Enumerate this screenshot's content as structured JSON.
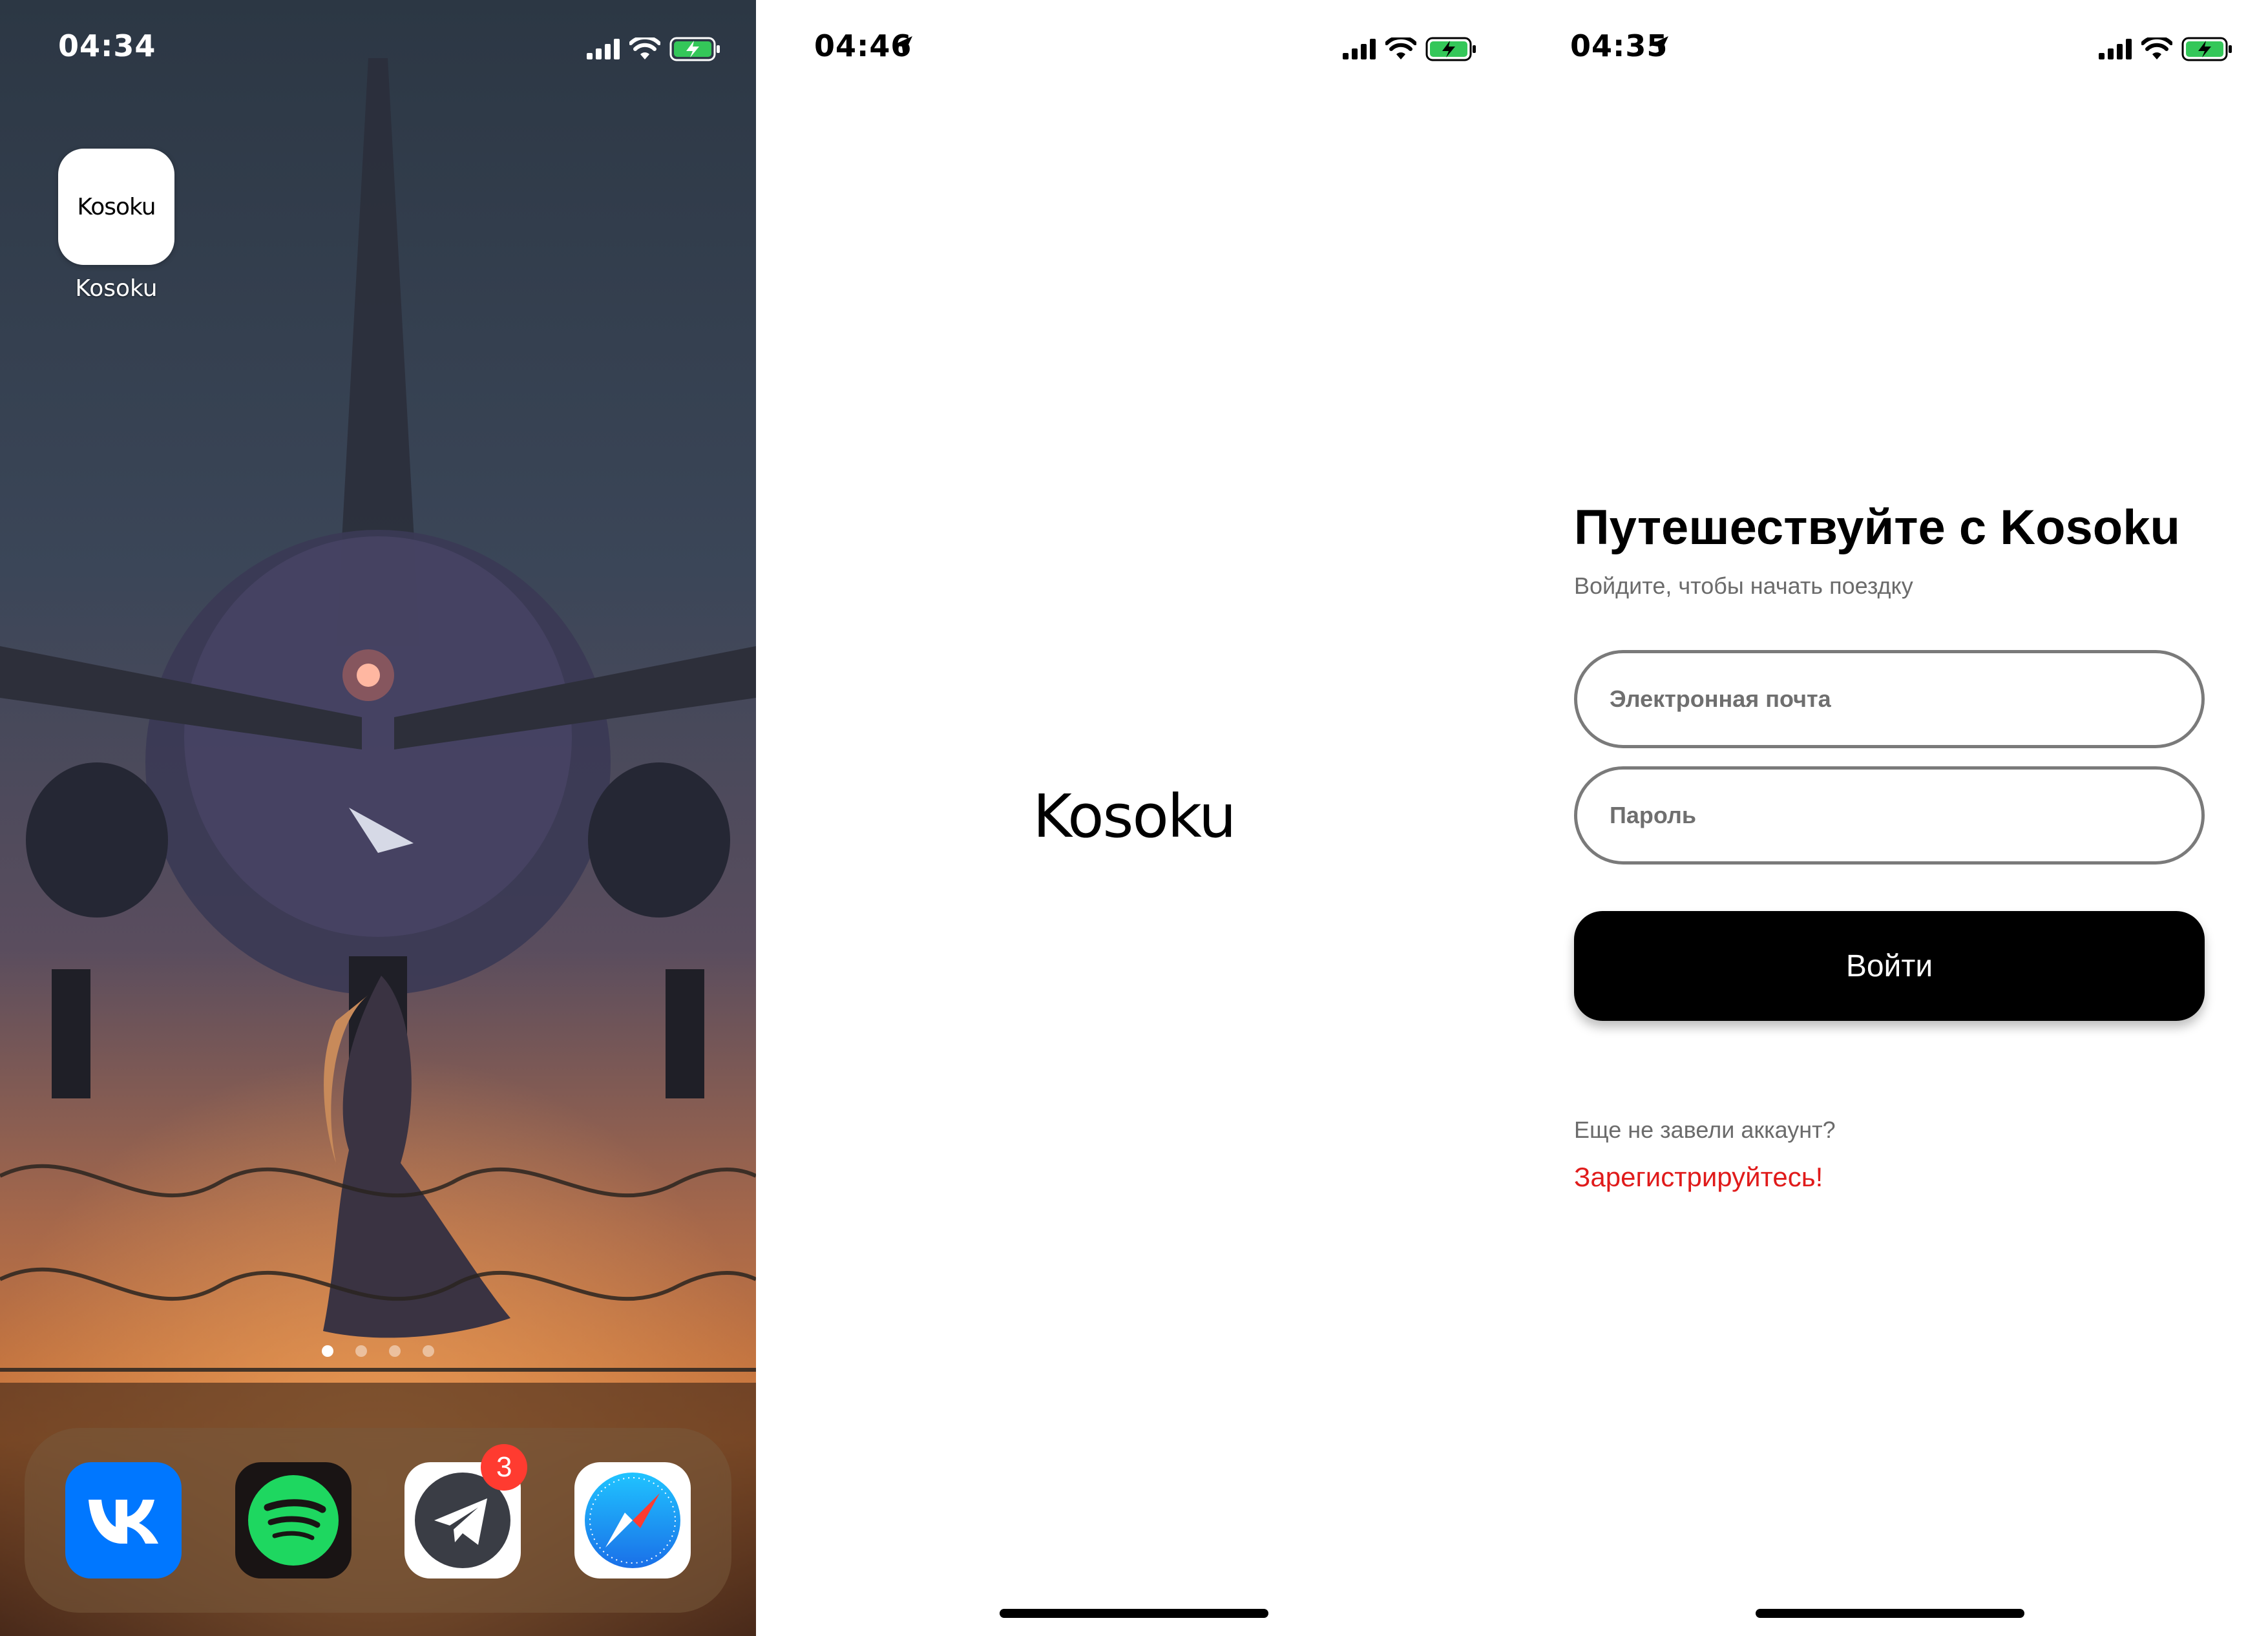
{
  "colors": {
    "accent_register": "#e01b1b",
    "button_bg": "#000000",
    "battery_green": "#34c759",
    "badge_red": "#ff3b30"
  },
  "home": {
    "status": {
      "time": "04:34"
    },
    "apps": [
      {
        "name": "Kosoku",
        "icon_text": "Kosoku"
      }
    ],
    "page_dots": 4,
    "active_page": 0,
    "dock": [
      {
        "app": "VK",
        "icon": "vk-icon"
      },
      {
        "app": "Spotify",
        "icon": "spotify-icon"
      },
      {
        "app": "Telegram",
        "icon": "telegram-icon",
        "badge": "3"
      },
      {
        "app": "Safari",
        "icon": "safari-icon"
      }
    ]
  },
  "splash": {
    "status": {
      "time": "04:46"
    },
    "logo": "Kosoku"
  },
  "login": {
    "status": {
      "time": "04:35"
    },
    "title": "Путешествуйте с Kosoku",
    "subtitle": "Войдите, чтобы начать поездку",
    "email_placeholder": "Электронная почта",
    "password_placeholder": "Пароль",
    "submit_label": "Войти",
    "no_account_text": "Еще не завели аккаунт?",
    "register_link": "Зарегистрируйтесь!"
  }
}
